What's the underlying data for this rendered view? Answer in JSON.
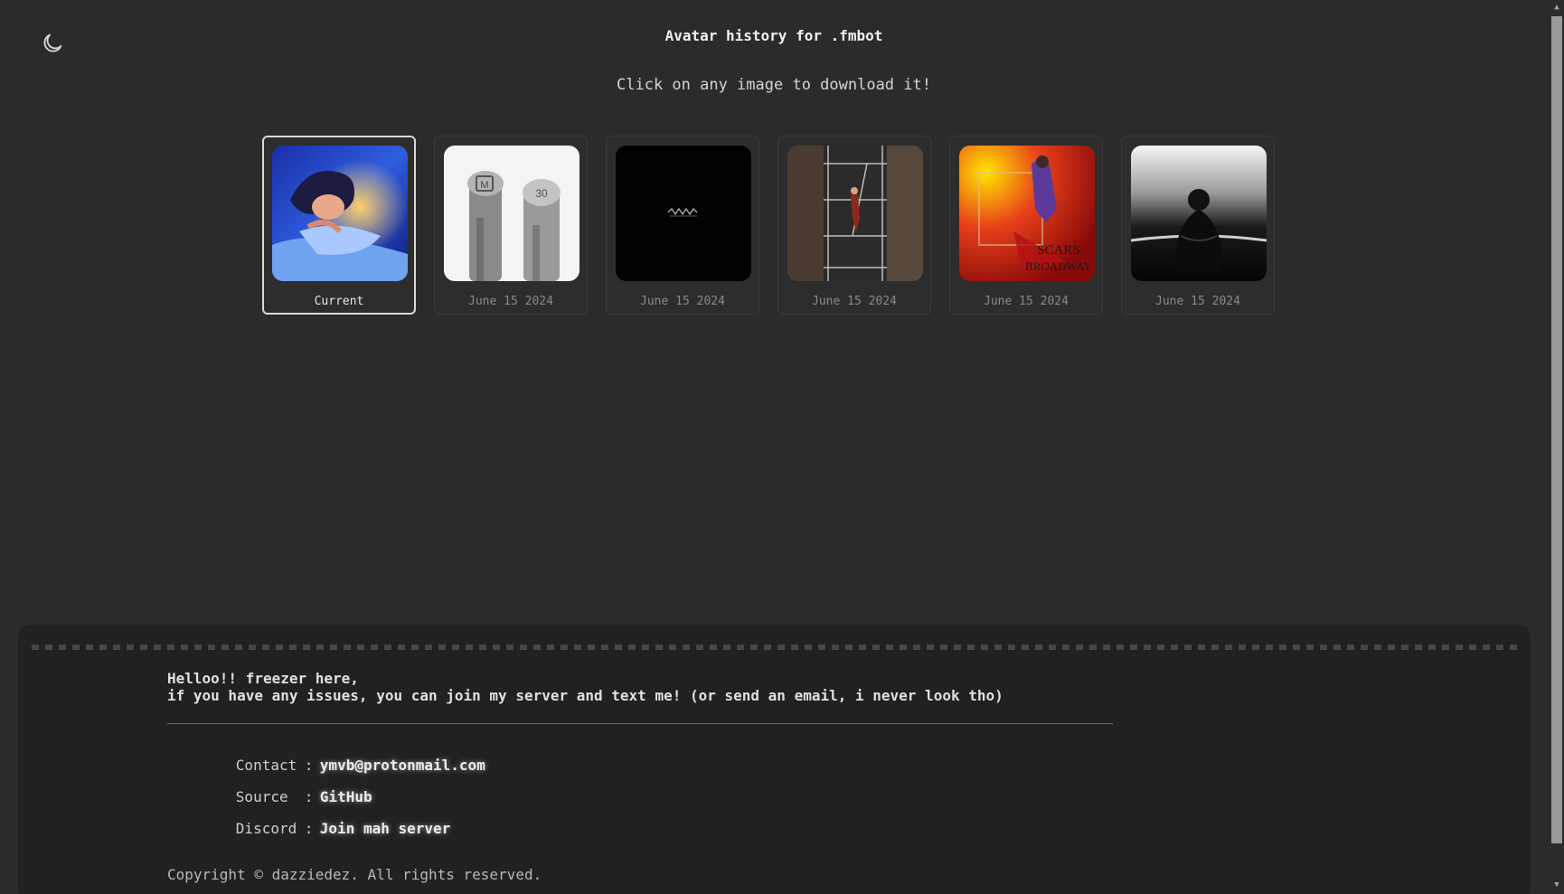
{
  "header": {
    "title": "Avatar history for .fmbot",
    "subtitle": "Click on any image to download it!",
    "theme_icon": "moon-icon"
  },
  "avatars": [
    {
      "label": "Current",
      "art": "blue-bedroom-portrait"
    },
    {
      "label": "June 15 2024",
      "art": "metal-stamps"
    },
    {
      "label": "June 15 2024",
      "art": "black-logo"
    },
    {
      "label": "June 15 2024",
      "art": "fire-escape"
    },
    {
      "label": "June 15 2024",
      "art": "scars-on-broadway"
    },
    {
      "label": "June 15 2024",
      "art": "dark-figure"
    }
  ],
  "footer": {
    "greeting_line1": "Helloo!! freezer here,",
    "greeting_line2": "if you have any issues, you can join my server and text me! (or send an email, i never look tho)",
    "contact_key": "Contact",
    "contact_value": "ymvb@protonmail.com",
    "source_key": "Source",
    "source_value": "GitHub",
    "discord_key": "Discord",
    "discord_value": "Join mah server",
    "separator": ":",
    "copyright": "Copyright © dazziedez. All rights reserved."
  },
  "colors": {
    "background": "#2b2b2b",
    "footer_background": "#212121",
    "current_border": "#d9d9d9"
  }
}
